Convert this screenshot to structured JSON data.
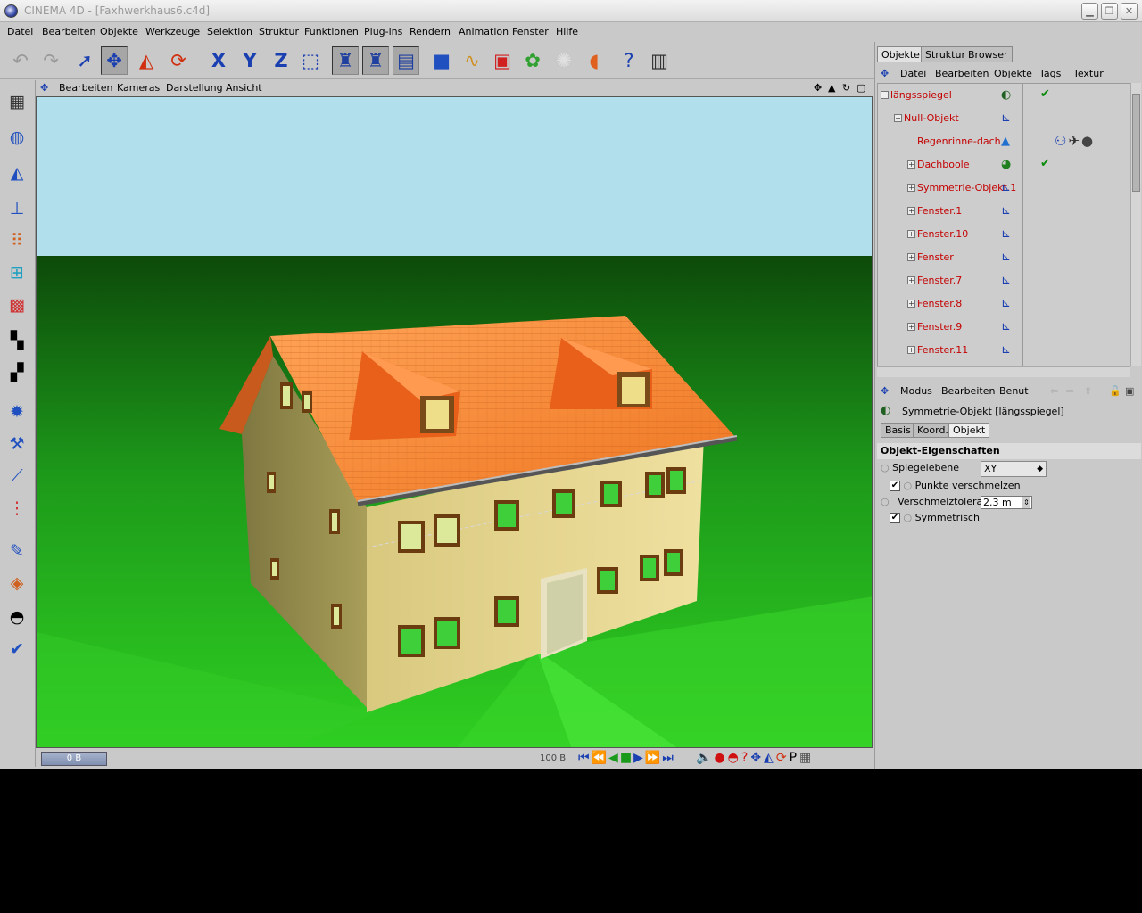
{
  "window": {
    "title": "CINEMA 4D - [Faxhwerkhaus6.c4d]",
    "buttons": [
      "▁",
      "❐",
      "✕"
    ]
  },
  "menubar": [
    "Datei",
    "Bearbeiten",
    "Objekte",
    "Werkzeuge",
    "Selektion",
    "Struktur",
    "Funktionen",
    "Plug-ins",
    "Rendern",
    "Animation",
    "Fenster",
    "Hilfe"
  ],
  "viewport_menu": [
    "Bearbeiten",
    "Kameras",
    "Darstellung",
    "Ansicht"
  ],
  "timeline": {
    "start_frame": "0 B",
    "end_frame": "100 B"
  },
  "panel_tabs": [
    "Objekte",
    "Struktur",
    "Browser"
  ],
  "object_manager": {
    "menu": [
      "Datei",
      "Bearbeiten",
      "Objekte",
      "Tags",
      "Textur"
    ],
    "rows": [
      {
        "label": "längsspiegel",
        "icon": "symmetry-icon",
        "checked": true
      },
      {
        "label": "Null-Objekt",
        "icon": "null-icon",
        "checked": false
      },
      {
        "label": "Regenrinne-dach",
        "icon": "cone-icon",
        "checked": false
      },
      {
        "label": "Dachboole",
        "icon": "boole-icon",
        "checked": true
      },
      {
        "label": "Symmetrie-Objekt.1",
        "icon": "null-icon",
        "checked": false
      },
      {
        "label": "Fenster.1",
        "icon": "null-icon",
        "checked": false
      },
      {
        "label": "Fenster.10",
        "icon": "null-icon",
        "checked": false
      },
      {
        "label": "Fenster",
        "icon": "null-icon",
        "checked": false
      },
      {
        "label": "Fenster.7",
        "icon": "null-icon",
        "checked": false
      },
      {
        "label": "Fenster.8",
        "icon": "null-icon",
        "checked": false
      },
      {
        "label": "Fenster.9",
        "icon": "null-icon",
        "checked": false
      },
      {
        "label": "Fenster.11",
        "icon": "null-icon",
        "checked": false
      }
    ]
  },
  "attributes": {
    "menu": [
      "Modus",
      "Bearbeiten",
      "Benut"
    ],
    "object_title": "Symmetrie-Objekt [längsspiegel]",
    "tabs": [
      "Basis",
      "Koord.",
      "Objekt"
    ],
    "active_tab": "Objekt",
    "section": "Objekt-Eigenschaften",
    "mirror_plane_label": "Spiegelebene",
    "mirror_plane_value": "XY",
    "weld_points_label": "Punkte verschmelzen",
    "weld_points_checked": true,
    "tolerance_label": "Verschmelztoleranz",
    "tolerance_value": "2.3 m",
    "symmetric_label": "Symmetrisch",
    "symmetric_checked": true
  },
  "colors": {
    "sky": "#b1e0ec",
    "ground": "#21b021",
    "roof": "#f07830",
    "wall": "#e2d28a",
    "ui_bg": "#c9c9c9",
    "object_label": "#c40000"
  }
}
